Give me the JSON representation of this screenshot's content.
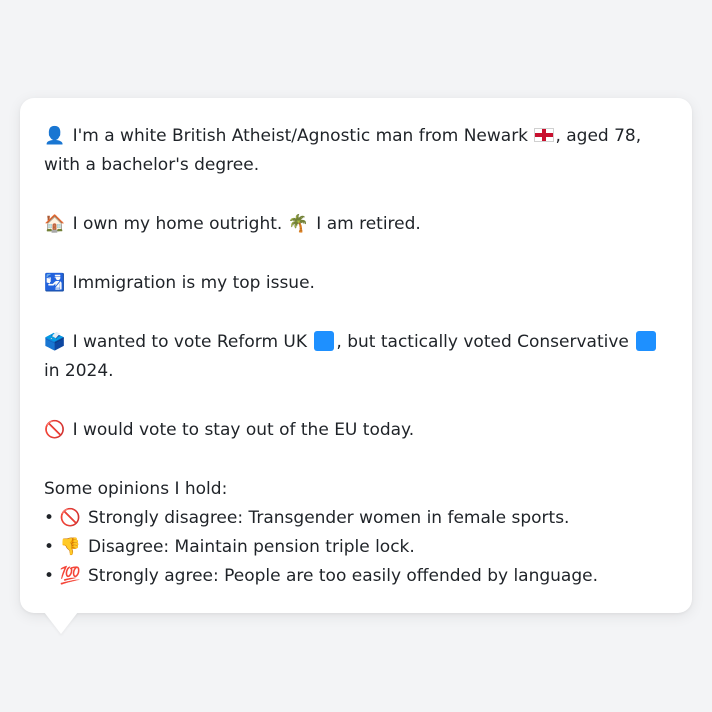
{
  "profile": {
    "intro": {
      "emoji": "👤",
      "before_flag": "I'm a white British Atheist/Agnostic man from Newark",
      "flag_icon": "england-flag-icon",
      "after_flag": ", aged 78, with a bachelor's degree."
    },
    "home": {
      "emoji": "🏠",
      "text1": "I own my home outright.",
      "emoji2": "🌴",
      "text2": "I am retired."
    },
    "issue": {
      "emoji": "🛂",
      "text": "Immigration is my top issue."
    },
    "vote": {
      "emoji": "🗳️",
      "text1": "I wanted to vote Reform UK",
      "reform_color": "#1e90ff",
      "text2": ", but tactically voted Conservative",
      "conservative_color": "#1e90ff",
      "text3": "in 2024."
    },
    "eu": {
      "emoji": "🚫",
      "text": "I would vote to stay out of the EU today."
    },
    "opinions": {
      "heading": "Some opinions I hold:",
      "items": [
        {
          "bullet": "•",
          "emoji": "🚫",
          "text": "Strongly disagree: Transgender women in female sports."
        },
        {
          "bullet": "•",
          "emoji": "👎",
          "text": "Disagree: Maintain pension triple lock."
        },
        {
          "bullet": "•",
          "emoji": "💯",
          "text": "Strongly agree: People are too easily offended by language."
        }
      ]
    }
  }
}
